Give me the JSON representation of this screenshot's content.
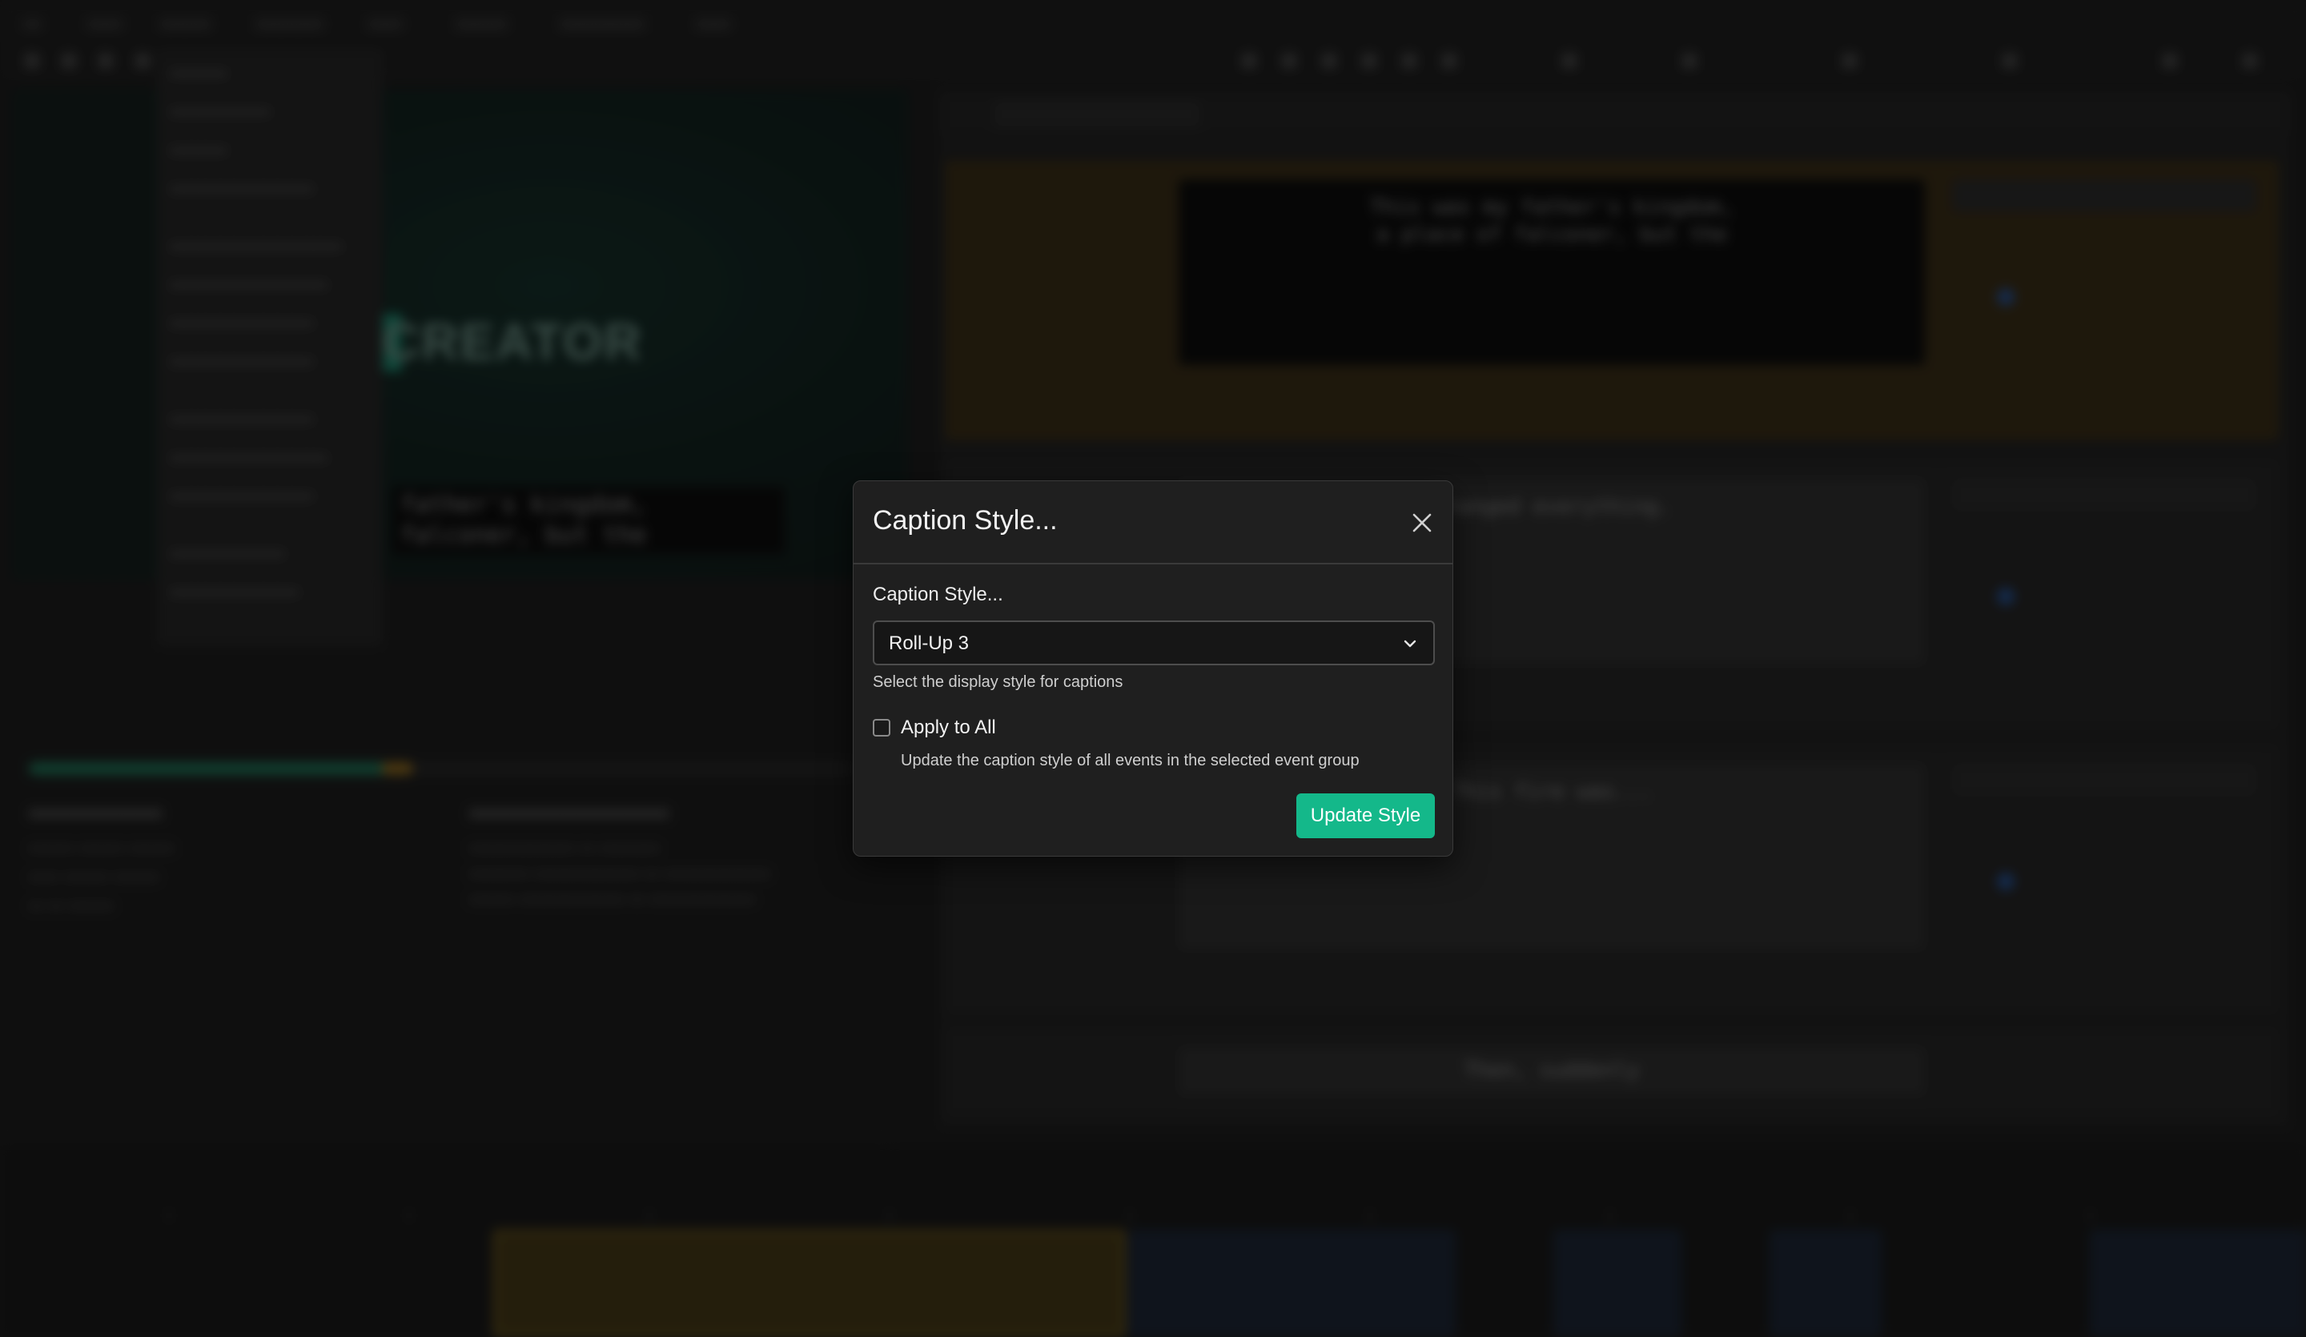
{
  "dialog": {
    "title": "Caption Style...",
    "field_label": "Caption Style...",
    "select_value": "Roll-Up 3",
    "select_help": "Select the display style for captions",
    "apply_all_label": "Apply to All",
    "apply_all_checked": false,
    "apply_all_description": "Update the caption style of all events in the selected event group",
    "primary_button": "Update Style",
    "accent_color": "#14b88a"
  },
  "background": {
    "preview_logo_text": "CREATOR",
    "preview_caption_lines": [
      "father's kingdom,",
      "falconer, but the"
    ],
    "events": [
      {
        "text": "This was my father's kingdom,\na place of falconer, but the"
      },
      {
        "text": "changed everything."
      },
      {
        "text": "This fire was..."
      },
      {
        "text": "Then, suddenly"
      }
    ]
  }
}
